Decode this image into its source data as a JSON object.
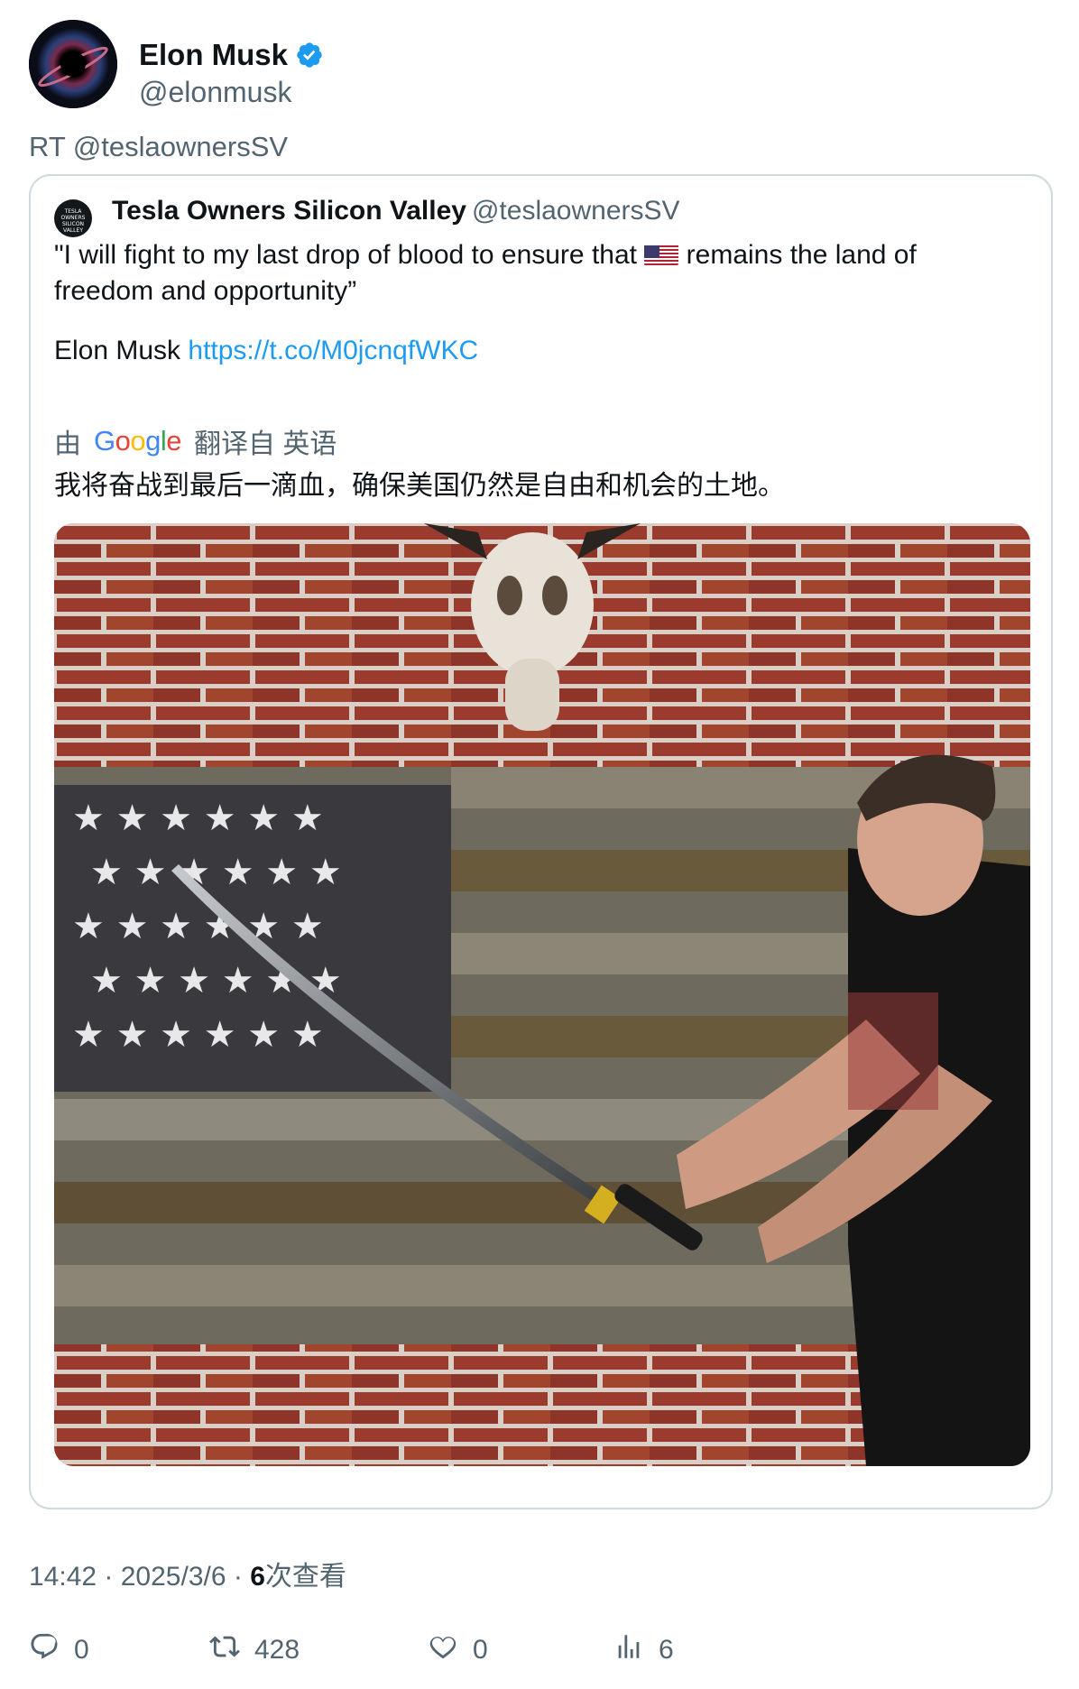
{
  "author": {
    "name": "Elon Musk",
    "handle": "@elonmusk",
    "verified_icon": "verified-badge-icon"
  },
  "retweet_line": "RT @teslaownersSV",
  "quoted": {
    "avatar_text": "TESLA OWNERS SILICON VALLEY",
    "name": "Tesla Owners Silicon Valley",
    "handle": "@teslaownersSV",
    "text_line1_before": "\"I will fight to my last drop of blood to ensure that",
    "text_line1_after": "remains the land of",
    "text_line2": "freedom and opportunity”",
    "text_line3_prefix": "Elon Musk ",
    "link": "https://t.co/M0jcnqfWKC",
    "flag_icon": "us-flag-emoji"
  },
  "translation": {
    "prefix": "由",
    "brand": "Google",
    "suffix": "翻译自 英语",
    "text": "我将奋战到最后一滴血，确保美国仍然是自由和机会的土地。"
  },
  "meta": {
    "time": "14:42",
    "date": "2025/3/6",
    "views_count": "6",
    "views_label": "次查看"
  },
  "actions": {
    "reply": "0",
    "retweet": "428",
    "like": "0",
    "views": "6"
  },
  "colors": {
    "accent": "#1d9bf0",
    "muted": "#536471",
    "border": "#cfd9de"
  }
}
